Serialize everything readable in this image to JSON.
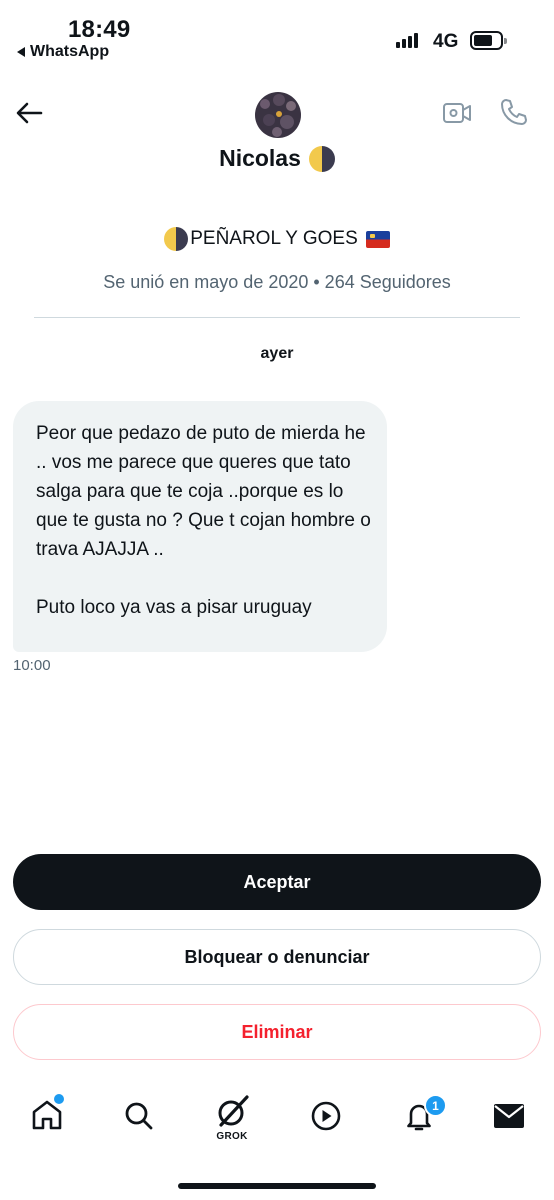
{
  "status_bar": {
    "time": "18:49",
    "back_app": "WhatsApp",
    "network": "4G"
  },
  "header": {
    "name": "Nicolas"
  },
  "profile": {
    "bio": "PEÑAROL Y GOES",
    "joined": "Se unió en mayo de 2020 • 264 Seguidores"
  },
  "conversation": {
    "day_label": "ayer",
    "message": {
      "paragraph1": "Peor que pedazo de puto de mierda he .. vos me parece que queres que tato salga para que te coja ..porque es lo que te gusta no ? Que t cojan hombre o trava AJAJJA ..",
      "paragraph2": "Puto loco ya vas a pisar uruguay",
      "time": "10:00"
    }
  },
  "actions": {
    "accept": "Aceptar",
    "block_report": "Bloquear o denunciar",
    "delete": "Eliminar"
  },
  "bottom_nav": {
    "grok_label": "GROK",
    "notifications_badge": "1",
    "items": [
      "home-icon",
      "search-icon",
      "grok-icon",
      "play-icon",
      "bell-icon",
      "mail-icon"
    ]
  },
  "colors": {
    "text": "#0f1419",
    "secondary": "#536471",
    "accent": "#1d9bf0",
    "danger": "#f4212e",
    "bubble": "#eff3f4"
  }
}
